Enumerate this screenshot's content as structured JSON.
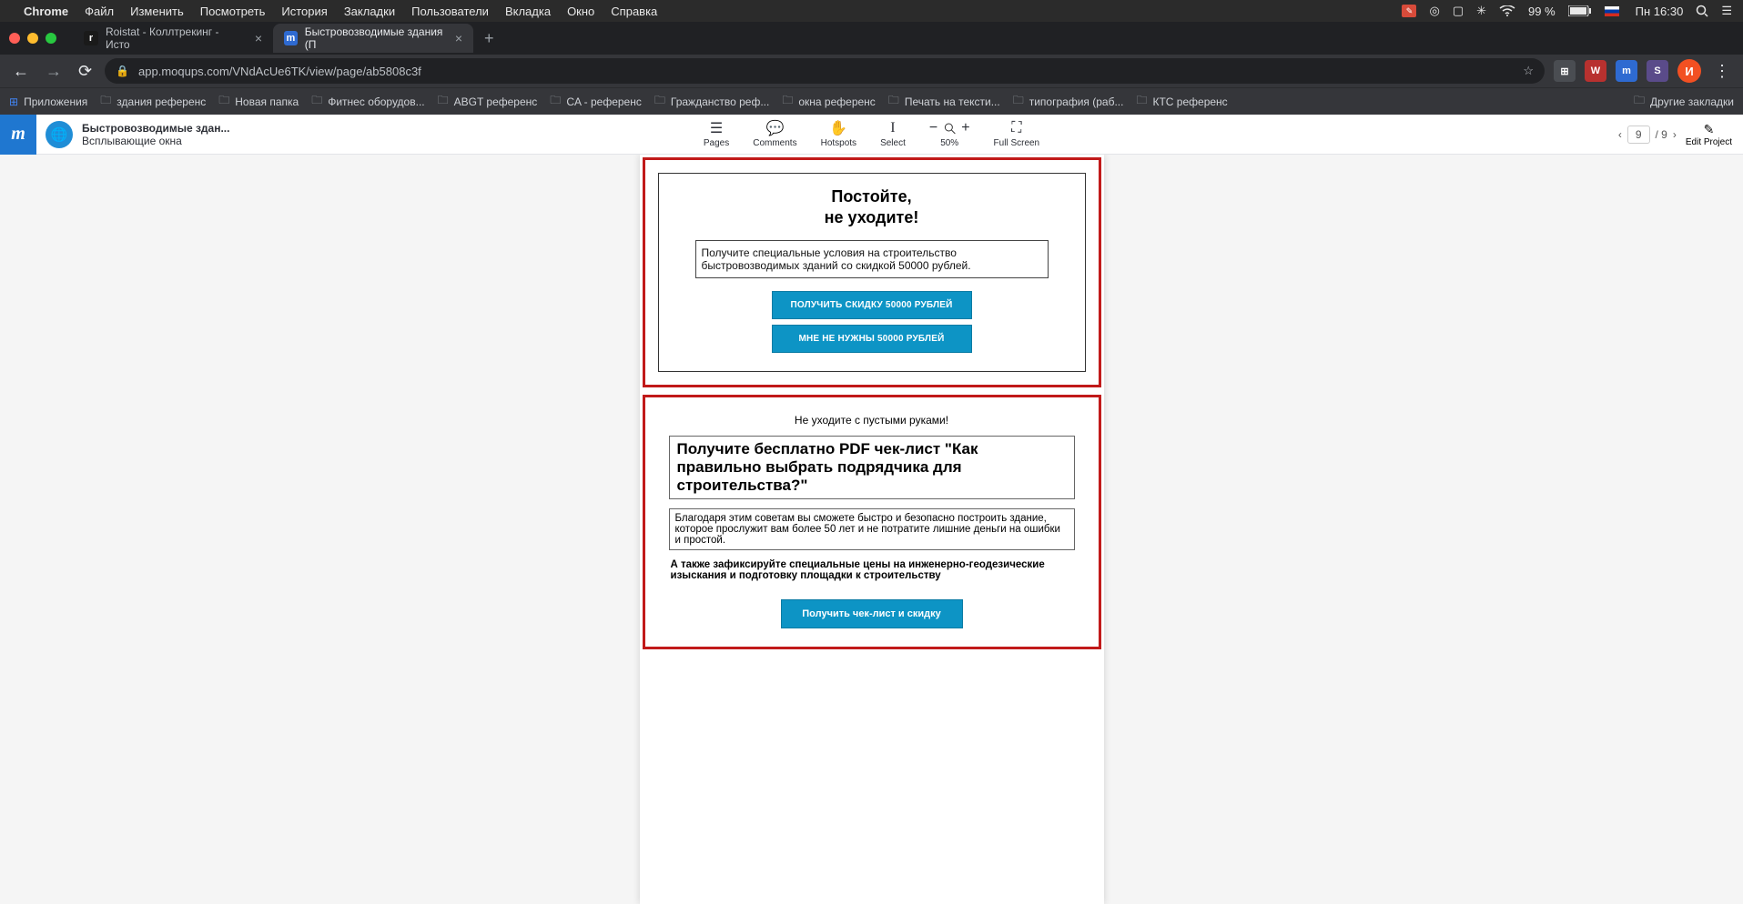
{
  "mac_menu": {
    "app": "Chrome",
    "items": [
      "Файл",
      "Изменить",
      "Посмотреть",
      "История",
      "Закладки",
      "Пользователи",
      "Вкладка",
      "Окно",
      "Справка"
    ],
    "battery": "99 %",
    "clock": "Пн 16:30"
  },
  "tabs": [
    {
      "favicon": "r",
      "title": "Roistat - Коллтрекинг - Исто",
      "active": false
    },
    {
      "favicon": "m",
      "title": "Быстровозводимые здания (П",
      "active": true
    }
  ],
  "address": "app.moqups.com/VNdAcUe6TK/view/page/ab5808c3f",
  "bookmarks": {
    "apps": "Приложения",
    "items": [
      "здания референс",
      "Новая папка",
      "Фитнес оборудов...",
      "ABGT референс",
      "CA - референс",
      "Гражданство реф...",
      "окна референс",
      "Печать на тексти...",
      "типография (раб...",
      "КТС референс"
    ],
    "other": "Другие закладки"
  },
  "moq": {
    "title": "Быстровозводимые здан...",
    "subtitle": "Всплывающие окна",
    "tools": {
      "pages": "Pages",
      "comments": "Comments",
      "hotspots": "Hotspots",
      "select": "Select",
      "zoom": "50%",
      "fullscreen": "Full Screen"
    },
    "page_current": "9",
    "page_total": "/ 9",
    "edit": "Edit Project"
  },
  "popup1": {
    "h1": "Постойте,",
    "h2": "не уходите!",
    "text": "Получите специальные условия на строительство быстровозводимых зданий со скидкой 50000 рублей.",
    "btn1": "ПОЛУЧИТЬ СКИДКУ 50000 РУБЛЕЙ",
    "btn2": "МНЕ НЕ НУЖНЫ 50000 РУБЛЕЙ"
  },
  "popup2": {
    "sub": "Не уходите с пустыми руками!",
    "heading": "Получите бесплатно PDF чек-лист \"Как правильно выбрать подрядчика для строительства?\"",
    "text": "Благодаря этим советам вы сможете быстро и безопасно построить здание, которое прослужит вам более 50 лет и не потратите лишние деньги на ошибки и простой.",
    "bold": "А также зафиксируйте специальные цены на инженерно-геодезические изыскания и подготовку площадки к строительству",
    "btn": "Получить чек-лист и скидку"
  },
  "avatar_letter": "И",
  "star": "☆"
}
